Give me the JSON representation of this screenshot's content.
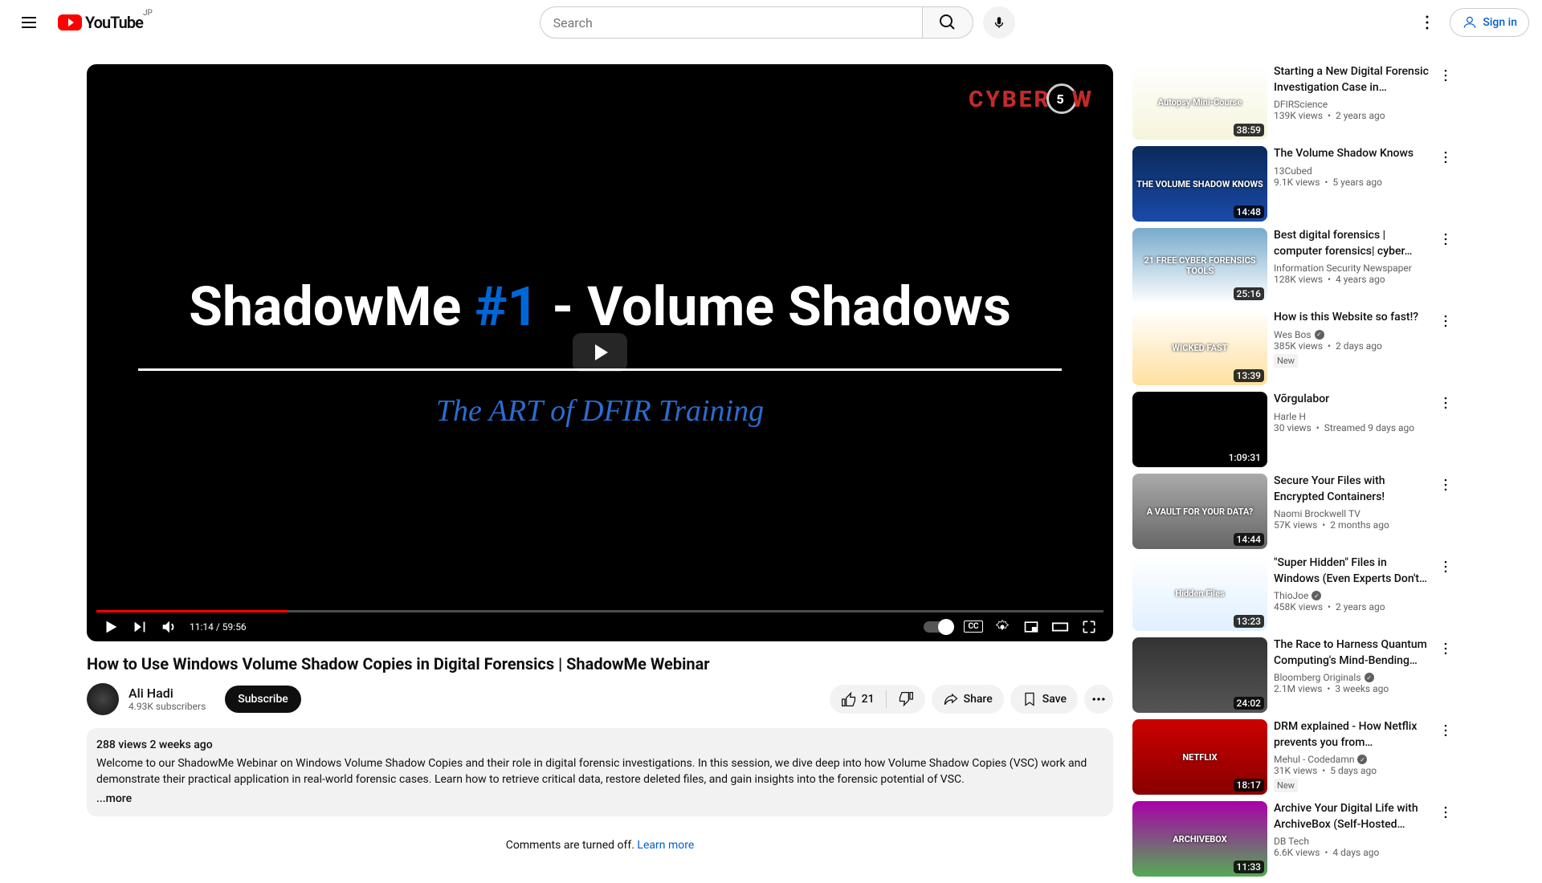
{
  "header": {
    "brand": "YouTube",
    "region": "JP",
    "search_placeholder": "Search",
    "signin": "Sign in"
  },
  "player": {
    "brand_left": "CYBER",
    "brand_right": "W",
    "brand_mid": "5",
    "line1_a": "ShadowMe ",
    "line1_b": "#1",
    "line1_c": " - Volume Shadows",
    "subtitle": "The ART of DFIR Training",
    "time_current": "11:14",
    "time_total": "59:56",
    "cc": "CC"
  },
  "video": {
    "title": "How to Use Windows Volume Shadow Copies in Digital Forensics | ShadowMe Webinar",
    "channel": "Ali Hadi",
    "subs": "4.93K subscribers",
    "subscribe": "Subscribe",
    "likes": "21",
    "share": "Share",
    "save": "Save"
  },
  "description": {
    "meta": "288 views  2 weeks ago",
    "body": "Welcome to our ShadowMe Webinar on Windows Volume Shadow Copies and their role in digital forensic investigations. In this session, we dive deep into how Volume Shadow Copies (VSC) work and demonstrate their practical application in real-world forensic cases. Learn how to retrieve critical data, restore deleted files, and gain insights into the forensic potential of VSC.",
    "more": "...more"
  },
  "comments": {
    "off": "Comments are turned off. ",
    "learn": "Learn more"
  },
  "recommendations": [
    {
      "title": "Starting a New Digital Forensic Investigation Case in Autopsy…",
      "channel": "DFIRScience",
      "views": "139K views",
      "age": "2 years ago",
      "dur": "38:59",
      "verified": false,
      "new": false,
      "thumb": "Autopsy Mini-Course"
    },
    {
      "title": "The Volume Shadow Knows",
      "channel": "13Cubed",
      "views": "9.1K views",
      "age": "5 years ago",
      "dur": "14:48",
      "verified": false,
      "new": false,
      "thumb": "THE VOLUME SHADOW KNOWS"
    },
    {
      "title": "Best digital forensics | computer forensics| cyber…",
      "channel": "Information Security Newspaper",
      "views": "128K views",
      "age": "4 years ago",
      "dur": "25:16",
      "verified": false,
      "new": false,
      "thumb": "21 FREE CYBER FORENSICS TOOLS"
    },
    {
      "title": "How is this Website so fast!?",
      "channel": "Wes Bos",
      "views": "385K views",
      "age": "2 days ago",
      "dur": "13:39",
      "verified": true,
      "new": true,
      "thumb": "WICKED FAST"
    },
    {
      "title": "Võrgulabor",
      "channel": "Harle H",
      "views": "30 views",
      "age": "Streamed 9 days ago",
      "dur": "1:09:31",
      "verified": false,
      "new": false,
      "thumb": ""
    },
    {
      "title": "Secure Your Files with Encrypted Containers!",
      "channel": "Naomi Brockwell TV",
      "views": "57K views",
      "age": "2 months ago",
      "dur": "14:44",
      "verified": false,
      "new": false,
      "thumb": "A VAULT FOR YOUR DATA?"
    },
    {
      "title": "\"Super Hidden\" Files in Windows (Even Experts Don't Know…",
      "channel": "ThioJoe",
      "views": "458K views",
      "age": "2 years ago",
      "dur": "13:23",
      "verified": true,
      "new": false,
      "thumb": "Hidden Files"
    },
    {
      "title": "The Race to Harness Quantum Computing's Mind-Bending…",
      "channel": "Bloomberg Originals",
      "views": "2.1M views",
      "age": "3 weeks ago",
      "dur": "24:02",
      "verified": true,
      "new": false,
      "thumb": ""
    },
    {
      "title": "DRM explained - How Netflix prevents you from downloadin…",
      "channel": "Mehul - Codedamn",
      "views": "31K views",
      "age": "5 days ago",
      "dur": "18:17",
      "verified": true,
      "new": true,
      "thumb": "NETFLIX"
    },
    {
      "title": "Archive Your Digital Life with ArchiveBox (Self-Hosted…",
      "channel": "DB Tech",
      "views": "6.6K views",
      "age": "4 days ago",
      "dur": "11:33",
      "verified": false,
      "new": false,
      "thumb": "ARCHIVEBOX"
    }
  ]
}
